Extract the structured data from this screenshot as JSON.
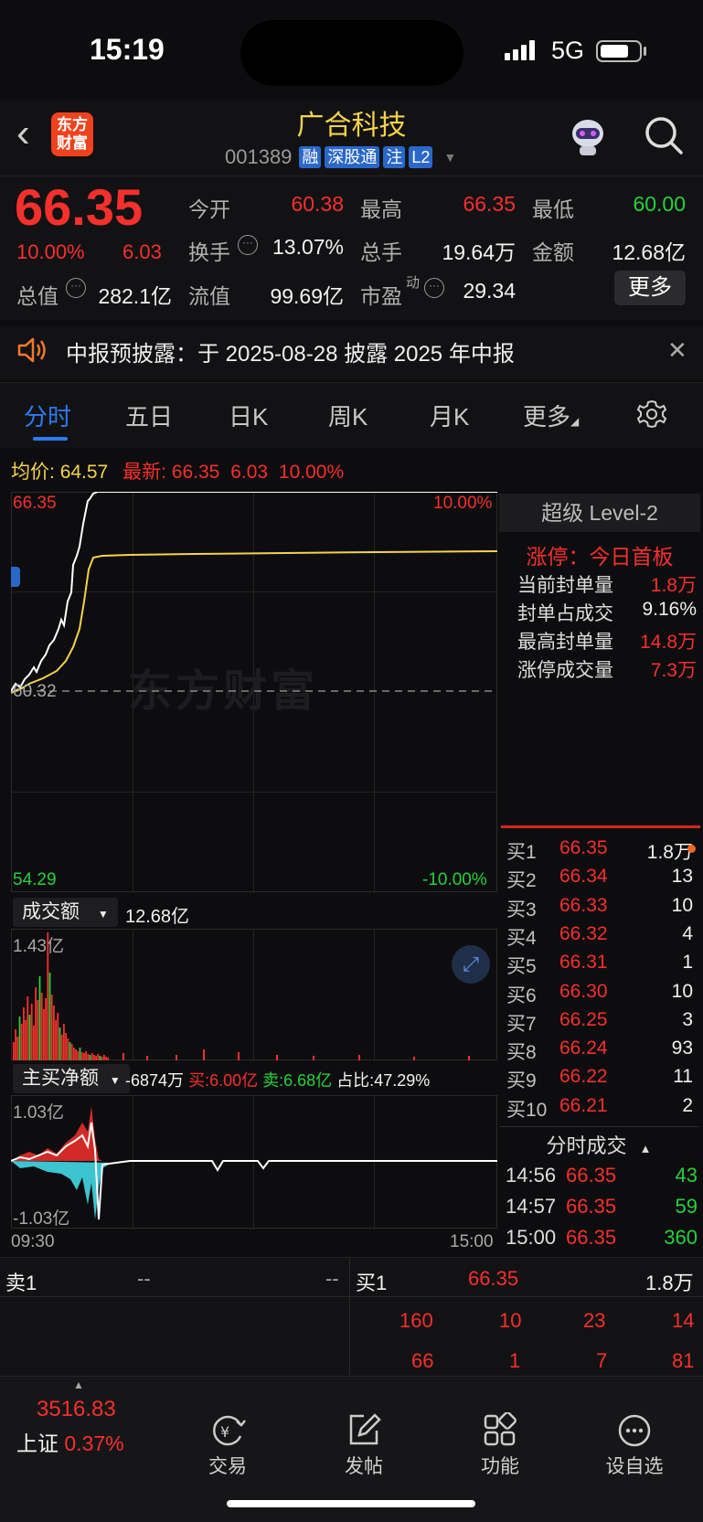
{
  "status": {
    "time": "15:19",
    "network": "5G"
  },
  "header": {
    "logo": "东方\n财富",
    "logo_line1": "东方",
    "logo_line2": "财富",
    "stock_name": "广合科技",
    "code": "001389",
    "tags": [
      "融",
      "深股通",
      "注",
      "L2"
    ]
  },
  "quote": {
    "price": "66.35",
    "pct": "10.00%",
    "change": "6.03",
    "open_label": "今开",
    "open": "60.38",
    "high_label": "最高",
    "high": "66.35",
    "low_label": "最低",
    "low": "60.00",
    "turnover_label": "换手",
    "turnover": "13.07%",
    "volume_label": "总手",
    "volume": "19.64万",
    "amount_label": "金额",
    "amount": "12.68亿",
    "mktcap_label": "总值",
    "mktcap": "282.1亿",
    "float_label": "流值",
    "float": "99.69亿",
    "pe_label": "市盈",
    "pe_sup": "动",
    "pe": "29.34",
    "more": "更多"
  },
  "notice": {
    "text": "中报预披露：于 2025-08-28 披露 2025 年中报"
  },
  "tabs": [
    "分时",
    "五日",
    "日K",
    "周K",
    "月K",
    "更多"
  ],
  "infoline": {
    "avg_label": "均价:",
    "avg": "64.57",
    "last_label": "最新:",
    "last": "66.35",
    "chg": "6.03",
    "pct": "10.00%"
  },
  "chart": {
    "top_price": "66.35",
    "top_pct": "10.00%",
    "mid_price": "60.32",
    "bottom_price": "54.29",
    "bottom_pct": "-10.00%",
    "watermark": "东方财富",
    "vol_title": "成交额",
    "vol_value": "12.68亿",
    "vol_max": "1.43亿",
    "flow_title": "主买净额",
    "flow_value": "-6874万",
    "flow_buy": "买:6.00亿",
    "flow_sell": "卖:6.68亿",
    "flow_ratio": "占比:47.29%",
    "flow_max": "1.03亿",
    "flow_min": "-1.03亿",
    "time_start": "09:30",
    "time_end": "15:00"
  },
  "level2": {
    "title": "超级 Level-2",
    "limit_status": "涨停：今日首板",
    "rows": [
      {
        "label": "当前封单量",
        "value": "1.8万"
      },
      {
        "label": "封单占成交",
        "value": "9.16%"
      },
      {
        "label": "最高封单量",
        "value": "14.8万"
      },
      {
        "label": "涨停成交量",
        "value": "7.3万"
      }
    ]
  },
  "book": [
    {
      "label": "买1",
      "price": "66.35",
      "vol": "1.8万"
    },
    {
      "label": "买2",
      "price": "66.34",
      "vol": "13"
    },
    {
      "label": "买3",
      "price": "66.33",
      "vol": "10"
    },
    {
      "label": "买4",
      "price": "66.32",
      "vol": "4"
    },
    {
      "label": "买5",
      "price": "66.31",
      "vol": "1"
    },
    {
      "label": "买6",
      "price": "66.30",
      "vol": "10"
    },
    {
      "label": "买7",
      "price": "66.25",
      "vol": "3"
    },
    {
      "label": "买8",
      "price": "66.24",
      "vol": "93"
    },
    {
      "label": "买9",
      "price": "66.22",
      "vol": "11"
    },
    {
      "label": "买10",
      "price": "66.21",
      "vol": "2"
    }
  ],
  "ticks": {
    "title": "分时成交",
    "rows": [
      {
        "time": "14:56",
        "price": "66.35",
        "vol": "43"
      },
      {
        "time": "14:57",
        "price": "66.35",
        "vol": "59"
      },
      {
        "time": "15:00",
        "price": "66.35",
        "vol": "360"
      }
    ]
  },
  "bottom_book": {
    "sell1_label": "卖1",
    "sell1_price": "--",
    "sell1_vol": "--",
    "buy1_label": "买1",
    "buy1_price": "66.35",
    "buy1_vol": "1.8万",
    "row2": [
      "160",
      "10",
      "23",
      "14"
    ],
    "row3": [
      "66",
      "1",
      "7",
      "81"
    ]
  },
  "tabbar": {
    "index_value": "3516.83",
    "index_name": "上证",
    "index_pct": "0.37%",
    "items": [
      "交易",
      "发帖",
      "功能",
      "设自选"
    ]
  },
  "colors": {
    "up": "#f5302c",
    "down": "#26d13b",
    "avg_line": "#f5d34a",
    "accent": "#2d7bf0"
  }
}
